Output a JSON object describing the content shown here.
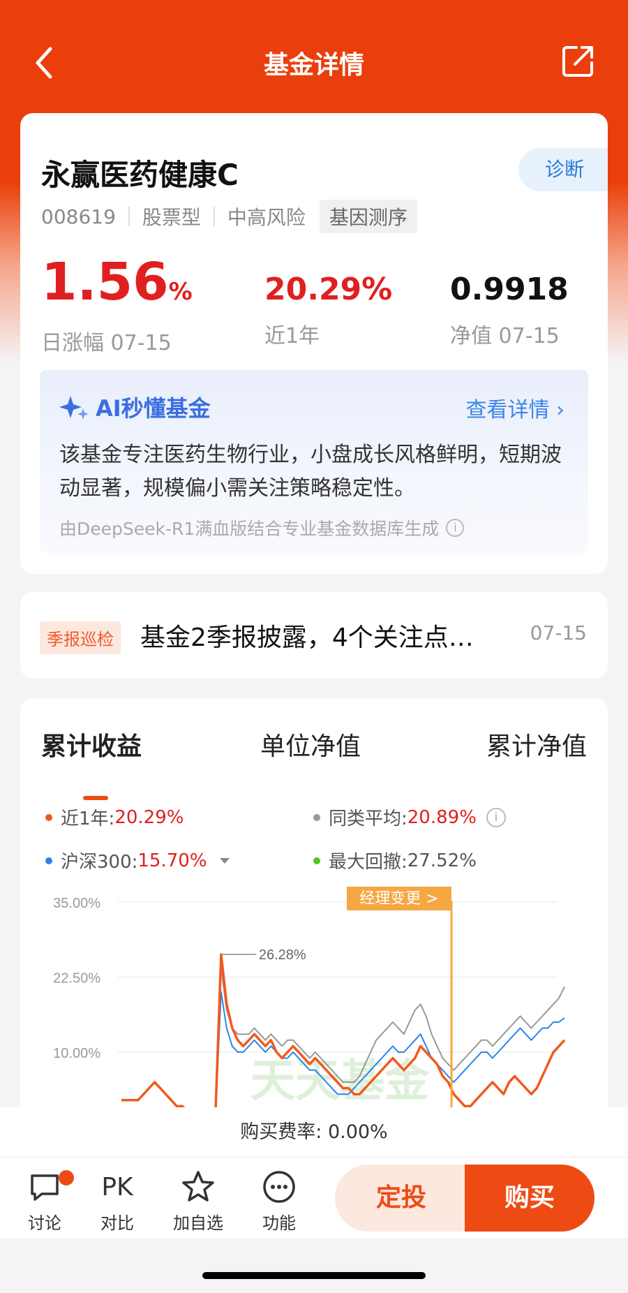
{
  "nav": {
    "title": "基金详情"
  },
  "fund": {
    "name": "永赢医药健康C",
    "diagnose_label": "诊断",
    "code": "008619",
    "type": "股票型",
    "risk": "中高风险",
    "gene": "基因测序",
    "daily_change": "1.56",
    "daily_change_unit": "%",
    "daily_change_label": "日涨幅 07-15",
    "year_return": "20.29%",
    "year_return_label": "近1年",
    "nav_value": "0.9918",
    "nav_label": "净值 07-15"
  },
  "ai": {
    "title": "AI秒懂基金",
    "more": "查看详情 ›",
    "text": "该基金专注医药生物行业，小盘成长风格鲜明，短期波动显著，规模偏小需关注策略稳定性。",
    "note": "由DeepSeek-R1满血版结合专业基金数据库生成",
    "info_icon": "i"
  },
  "news": {
    "badge": "季报巡检",
    "text": "基金2季报披露，4个关注点…",
    "date": "07-15"
  },
  "chart_tabs": [
    "累计收益",
    "单位净值",
    "累计净值"
  ],
  "legend": {
    "l1_label": "近1年:",
    "l1_value": "20.29%",
    "l2_label": "同类平均:",
    "l2_value": "20.89%",
    "l3_label": "沪深300:",
    "l3_value": "15.70%",
    "l4_label": "最大回撤:",
    "l4_value": "27.52%",
    "info_icon": "i"
  },
  "chart_data": {
    "type": "line",
    "yticks": [
      "35.00%",
      "22.50%",
      "10.00%"
    ],
    "ylim": [
      0,
      35
    ],
    "peak_label": "26.28%",
    "manager_change_label": "经理变更 >",
    "watermark": "天天基金",
    "colors": {
      "fund": "#f05a1e",
      "peer": "#999999",
      "hs300": "#2a86e6",
      "drawdown": "#52c41a"
    },
    "series": [
      {
        "name": "近1年",
        "values": [
          2,
          2,
          2,
          2,
          3,
          4,
          5,
          4,
          3,
          2,
          1,
          1,
          0,
          0,
          0,
          0,
          0,
          0,
          26.28,
          18,
          14,
          12,
          11,
          12,
          13,
          12,
          11,
          12,
          10,
          9,
          10,
          11,
          10,
          9,
          8,
          9,
          8,
          7,
          6,
          5,
          4,
          4,
          3,
          3,
          4,
          5,
          6,
          7,
          8,
          9,
          8,
          7,
          8,
          9,
          11,
          10,
          9,
          8,
          6,
          5,
          3,
          2,
          1,
          1,
          2,
          3,
          4,
          5,
          4,
          3,
          5,
          6,
          5,
          4,
          3,
          4,
          6,
          8,
          10,
          11,
          12
        ]
      },
      {
        "name": "同类平均",
        "values": [
          0,
          0,
          0,
          0,
          0,
          0,
          0,
          0,
          0,
          0,
          0,
          0,
          0,
          0,
          0,
          0,
          0,
          0,
          24,
          17,
          14,
          13,
          13,
          13,
          14,
          13,
          12,
          13,
          12,
          11,
          12,
          12,
          11,
          10,
          9,
          10,
          9,
          8,
          7,
          6,
          5,
          5,
          5,
          6,
          8,
          10,
          12,
          13,
          14,
          15,
          14,
          13,
          15,
          17,
          18,
          16,
          13,
          11,
          9,
          8,
          7,
          8,
          9,
          10,
          11,
          12,
          12,
          11,
          12,
          13,
          14,
          15,
          16,
          15,
          14,
          15,
          16,
          17,
          18,
          19,
          20.89
        ]
      },
      {
        "name": "沪深300",
        "values": [
          0,
          0,
          0,
          0,
          0,
          0,
          0,
          0,
          0,
          0,
          0,
          0,
          0,
          0,
          0,
          0,
          0,
          0,
          20,
          14,
          11,
          10,
          10,
          11,
          12,
          11,
          10,
          11,
          10,
          9,
          9,
          10,
          9,
          8,
          7,
          7,
          6,
          5,
          4,
          3,
          3,
          3,
          4,
          5,
          6,
          7,
          8,
          9,
          10,
          11,
          10,
          10,
          11,
          12,
          13,
          11,
          9,
          8,
          7,
          6,
          5,
          6,
          7,
          8,
          9,
          10,
          10,
          9,
          10,
          11,
          12,
          13,
          14,
          13,
          12,
          13,
          14,
          14,
          15,
          15,
          15.7
        ]
      }
    ]
  },
  "fee": "购买费率: 0.00%",
  "bottom": {
    "discuss": "讨论",
    "pk_icon": "PK",
    "compare": "对比",
    "add": "加自选",
    "func": "功能",
    "dingtou": "定投",
    "buy": "购买"
  }
}
